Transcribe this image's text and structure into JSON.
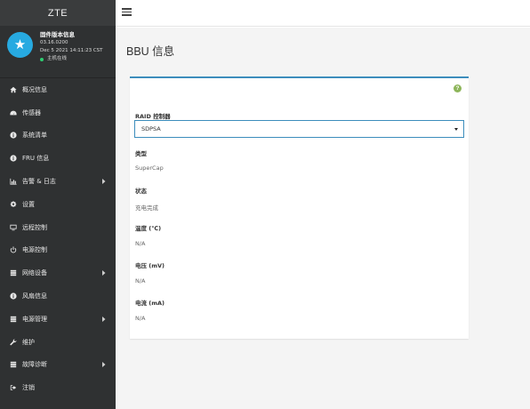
{
  "brand": "ZTE",
  "user": {
    "title": "固件版本信息",
    "version": "03.16.0200",
    "datetime": "Dec 5 2021 14:11:23 CST",
    "status": "主机在线"
  },
  "menu": [
    {
      "label": "概况信息",
      "icon": "home-icon",
      "has_children": false
    },
    {
      "label": "传感器",
      "icon": "dashboard-icon",
      "has_children": false
    },
    {
      "label": "系统清单",
      "icon": "info-icon",
      "has_children": false
    },
    {
      "label": "FRU 信息",
      "icon": "info-icon",
      "has_children": false
    },
    {
      "label": "告警 & 日志",
      "icon": "bar-chart-icon",
      "has_children": true
    },
    {
      "label": "设置",
      "icon": "gear-icon",
      "has_children": false
    },
    {
      "label": "远程控制",
      "icon": "monitor-icon",
      "has_children": false
    },
    {
      "label": "电源控制",
      "icon": "power-icon",
      "has_children": false
    },
    {
      "label": "网络设备",
      "icon": "server-icon",
      "has_children": true
    },
    {
      "label": "风扇信息",
      "icon": "info-icon",
      "has_children": false
    },
    {
      "label": "电源管理",
      "icon": "server-icon",
      "has_children": true
    },
    {
      "label": "维护",
      "icon": "wrench-icon",
      "has_children": false
    },
    {
      "label": "故障诊断",
      "icon": "server-icon",
      "has_children": true
    },
    {
      "label": "注销",
      "icon": "sign-out-icon",
      "has_children": false
    }
  ],
  "page": {
    "title": "BBU 信息"
  },
  "panel": {
    "help_icon": "?",
    "raid_label": "RAID 控制器",
    "raid_selected": "SDPSA",
    "type_label": "类型",
    "type_value": "SuperCap",
    "status_label": "状态",
    "status_value": "充电完成",
    "temp_label": "温度 (℃)",
    "temp_value": "N/A",
    "voltage_label": "电压 (mV)",
    "voltage_value": "N/A",
    "current_label": "电流 (mA)",
    "current_value": "N/A"
  },
  "colors": {
    "sidebar_bg": "#2f3132",
    "avatar": "#27aae1",
    "accent": "#3c8dbc",
    "online": "#2ecc71",
    "help": "#8db55a"
  }
}
